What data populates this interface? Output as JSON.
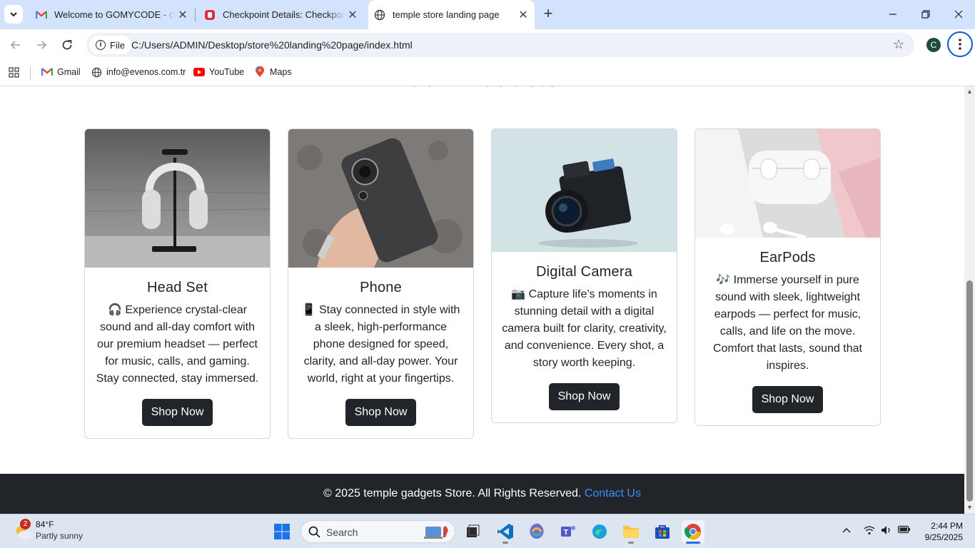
{
  "browser": {
    "tabs": [
      {
        "title": "Welcome to GOMYCODE - chijioke",
        "active": false,
        "favicon": "gmail-icon"
      },
      {
        "title": "Checkpoint Details: Checkpoint",
        "active": false,
        "favicon": "gomycode-icon"
      },
      {
        "title": "temple store landing page",
        "active": true,
        "favicon": "globe-icon"
      }
    ],
    "chip_label": "File",
    "url": "C:/Users/ADMIN/Desktop/store%20landing%20page/index.html",
    "profile_initial": "C",
    "bookmarks": [
      {
        "label": "Gmail",
        "icon": "gmail-icon"
      },
      {
        "label": "info@evenos.com.tr",
        "icon": "globe-icon"
      },
      {
        "label": "YouTube",
        "icon": "youtube-icon"
      },
      {
        "label": "Maps",
        "icon": "maps-icon"
      }
    ]
  },
  "page": {
    "section_heading": "Our Products",
    "products": [
      {
        "name": "Head Set",
        "emoji": "🎧",
        "description": "Experience crystal-clear sound and all-day comfort with our premium headset — perfect for music, calls, and gaming. Stay connected, stay immersed.",
        "button": "Shop Now",
        "image": "headset-image"
      },
      {
        "name": "Phone",
        "emoji": "📱",
        "description": "Stay connected in style with a sleek, high-performance phone designed for speed, clarity, and all-day power. Your world, right at your fingertips.",
        "button": "Shop Now",
        "image": "phone-image"
      },
      {
        "name": "Digital Camera",
        "emoji": "📷",
        "description": "Capture life’s moments in stunning detail with a digital camera built for clarity, creativity, and convenience. Every shot, a story worth keeping.",
        "button": "Shop Now",
        "image": "camera-image"
      },
      {
        "name": "EarPods",
        "emoji": "🎶",
        "description": "Immerse yourself in pure sound with sleek, lightweight earpods — perfect for music, calls, and life on the move. Comfort that lasts, sound that inspires.",
        "button": "Shop Now",
        "image": "earpods-image"
      }
    ],
    "footer": {
      "text": "© 2025 temple gadgets Store. All Rights Reserved.",
      "link": "Contact Us"
    }
  },
  "taskbar": {
    "weather_badge": "2",
    "weather_temp": "84°F",
    "weather_condition": "Partly sunny",
    "search_label": "Search",
    "time": "2:44 PM",
    "date": "9/25/2025"
  },
  "colors": {
    "tabstrip": "#d3e3fd",
    "card_button": "#212529",
    "footer_bg": "#212529",
    "footer_link": "#3d8bfd",
    "profile_avatar": "#1e4d3b"
  }
}
